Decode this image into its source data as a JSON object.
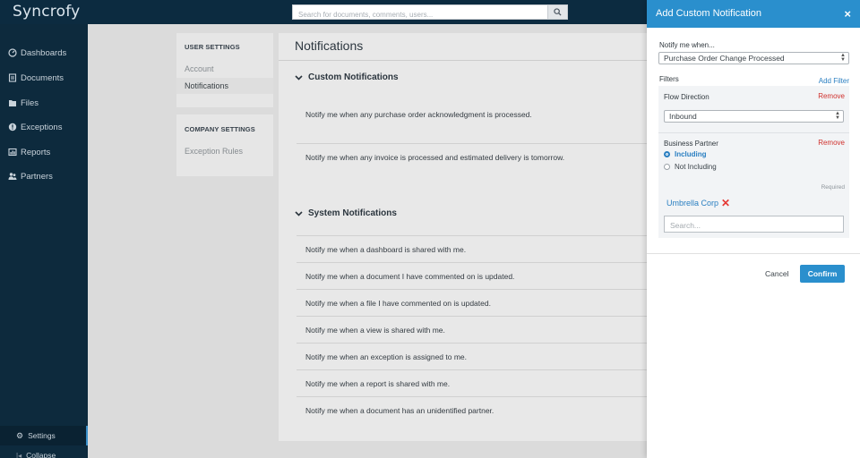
{
  "app": {
    "logo": "Syncrofy"
  },
  "search": {
    "placeholder": "Search for documents, comments, users..."
  },
  "sidebar": {
    "items": [
      {
        "label": "Dashboards",
        "icon": "dashboard-icon"
      },
      {
        "label": "Documents",
        "icon": "documents-icon"
      },
      {
        "label": "Files",
        "icon": "files-icon"
      },
      {
        "label": "Exceptions",
        "icon": "exceptions-icon"
      },
      {
        "label": "Reports",
        "icon": "reports-icon"
      },
      {
        "label": "Partners",
        "icon": "partners-icon"
      }
    ],
    "settings_label": "Settings",
    "collapse_label": "Collapse"
  },
  "settings_nav": {
    "user_heading": "USER SETTINGS",
    "user_links": [
      "Account",
      "Notifications"
    ],
    "company_heading": "COMPANY SETTINGS",
    "company_links": [
      "Exception Rules"
    ]
  },
  "main": {
    "title": "Notifications",
    "custom_heading": "Custom Notifications",
    "custom_items": [
      "Notify me when any purchase order acknowledgment is processed.",
      "Notify me when any invoice is processed and estimated delivery is tomorrow."
    ],
    "system_heading": "System Notifications",
    "system_items": [
      "Notify me when a dashboard is shared with me.",
      "Notify me when a document I have commented on is updated.",
      "Notify me when a file I have commented on is updated.",
      "Notify me when a view is shared with me.",
      "Notify me when an exception is assigned to me.",
      "Notify me when a report is shared with me.",
      "Notify me when a document has an unidentified partner."
    ]
  },
  "panel": {
    "title": "Add Custom Notification",
    "close": "×",
    "notify_label": "Notify me when...",
    "notify_value": "Purchase Order Change Processed",
    "filters_label": "Filters",
    "add_filter": "Add Filter",
    "flow_label": "Flow Direction",
    "remove": "Remove",
    "flow_value": "Inbound",
    "partner_label": "Business Partner",
    "radio_including": "Including",
    "radio_not_including": "Not Including",
    "required": "Required",
    "tag": "Umbrella Corp",
    "search_placeholder": "Search...",
    "cancel": "Cancel",
    "confirm": "Confirm"
  },
  "colors": {
    "accent": "#2a8fcd",
    "sidebar": "#0d2a3d",
    "danger": "#d0312d"
  }
}
